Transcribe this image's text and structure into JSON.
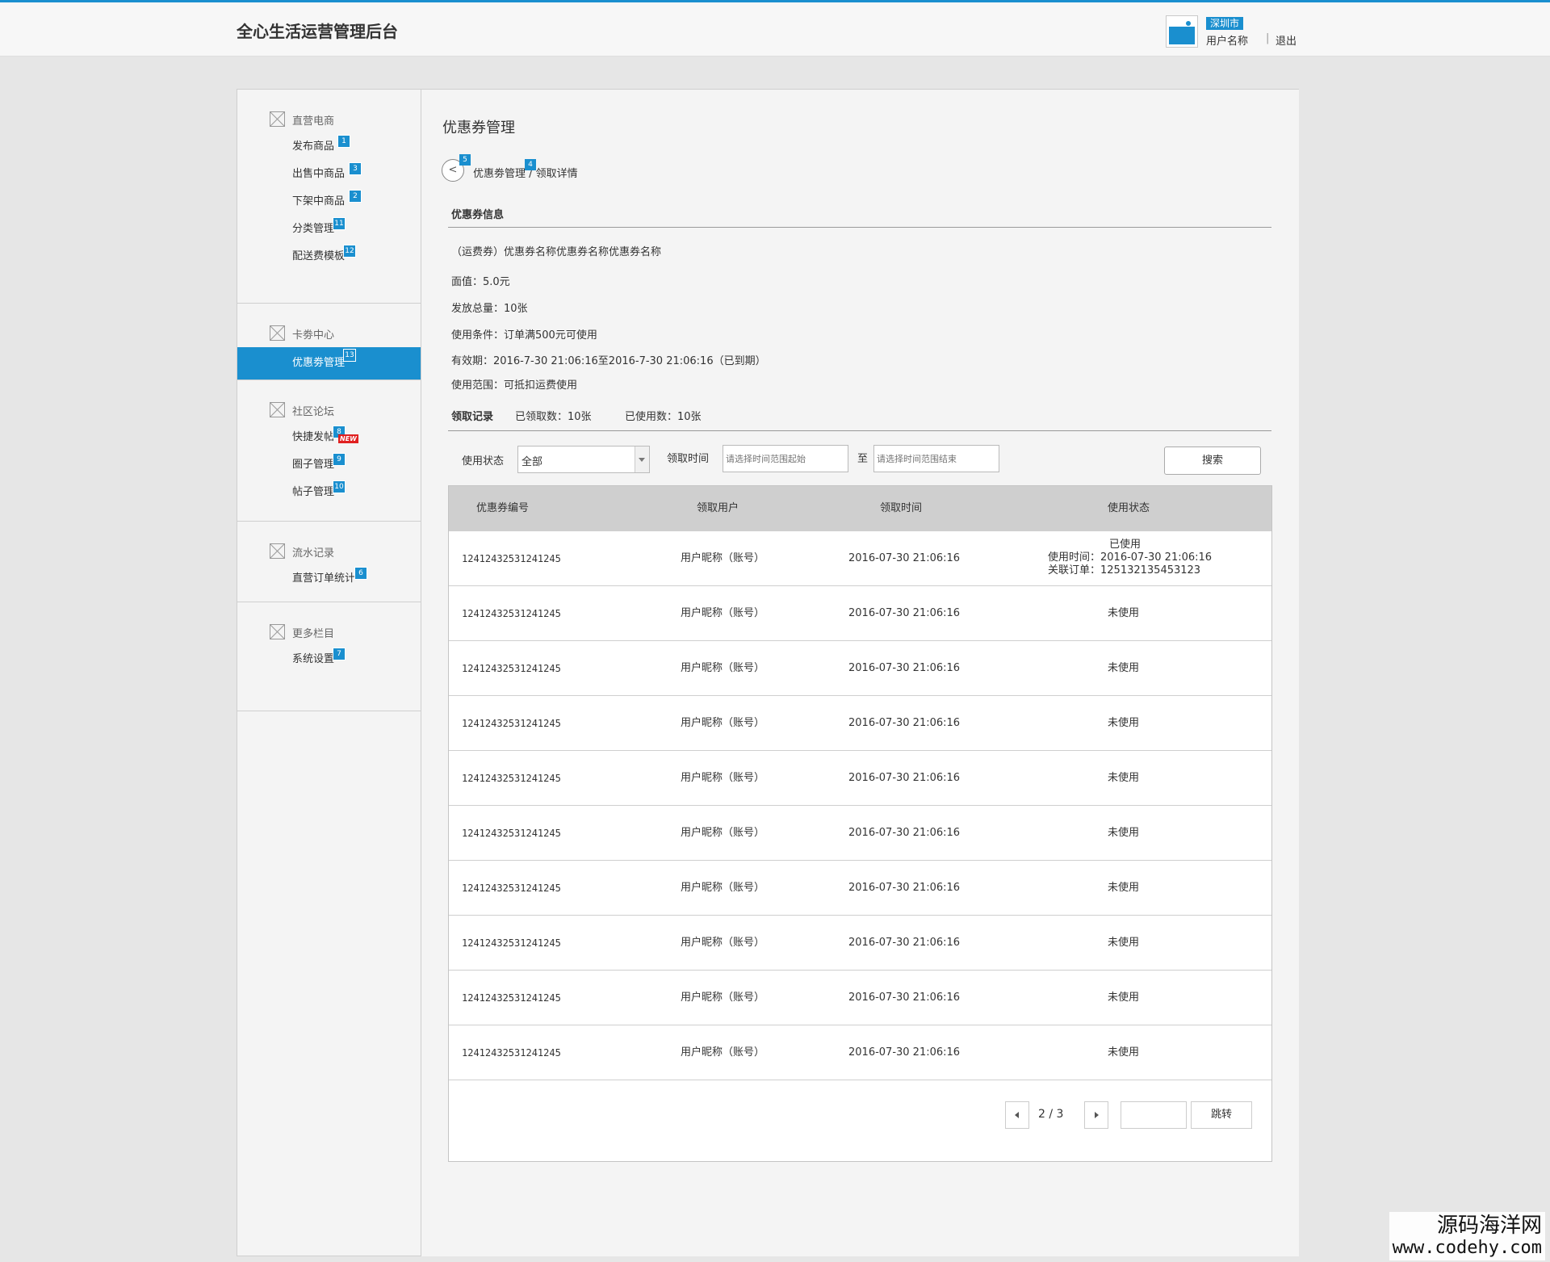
{
  "header": {
    "title": "全心生活运营管理后台",
    "city": "深圳市",
    "username": "用户名称",
    "separator": "|",
    "logout": "退出"
  },
  "sidebar": {
    "groups": [
      {
        "title": "直营电商",
        "items": [
          {
            "label": "发布商品",
            "badge": "1"
          },
          {
            "label": "出售中商品",
            "badge": "3"
          },
          {
            "label": "下架中商品",
            "badge": "2"
          },
          {
            "label": "分类管理",
            "badge": "11"
          },
          {
            "label": "配送费模板",
            "badge": "12"
          }
        ]
      },
      {
        "title": "卡劵中心",
        "items": [
          {
            "label": "优惠劵管理",
            "badge": "13",
            "active": true
          }
        ]
      },
      {
        "title": "社区论坛",
        "items": [
          {
            "label": "快捷发帖",
            "badge": "8",
            "new": "NEW"
          },
          {
            "label": "圈子管理",
            "badge": "9"
          },
          {
            "label": "帖子管理",
            "badge": "10"
          }
        ]
      },
      {
        "title": "流水记录",
        "items": [
          {
            "label": "直营订单统计",
            "badge": "6"
          }
        ]
      },
      {
        "title": "更多栏目",
        "items": [
          {
            "label": "系统设置",
            "badge": "7"
          }
        ]
      }
    ]
  },
  "main": {
    "page_title": "优惠券管理",
    "back_label": "<",
    "back_badge": "5",
    "breadcrumb": {
      "parent": "优惠劵管理",
      "parent_badge": "4",
      "sep": " / ",
      "current": "领取详情"
    },
    "info_title": "优惠券信息",
    "coupon_name": "（运费券）优惠券名称优惠券名称优惠券名称",
    "face_value": "面值：5.0元",
    "total": "发放总量：10张",
    "condition": "使用条件：订单满500元可使用",
    "validity": "有效期：2016-7-30 21:06:16至2016-7-30 21:06:16（已到期）",
    "scope": "使用范围：可抵扣运费使用",
    "records_title": "领取记录",
    "received": "已领取数：10张",
    "used": "已使用数：10张",
    "filter": {
      "status_label": "使用状态",
      "status_value": "全部",
      "time_label": "领取时间",
      "start_placeholder": "请选择时间范围起始",
      "to": "至",
      "end_placeholder": "请选择时间范围结束",
      "search": "搜索"
    },
    "table": {
      "headers": [
        "优惠券编号",
        "领取用户",
        "领取时间",
        "使用状态"
      ],
      "rows": [
        {
          "code": "12412432531241245",
          "user": "用户昵称（账号）",
          "time": "2016-07-30 21:06:16",
          "status": "已使用",
          "used_time": "使用时间：2016-07-30 21:06:16",
          "order": "关联订单：125132135453123"
        },
        {
          "code": "12412432531241245",
          "user": "用户昵称（账号）",
          "time": "2016-07-30 21:06:16",
          "status": "未使用"
        },
        {
          "code": "12412432531241245",
          "user": "用户昵称（账号）",
          "time": "2016-07-30 21:06:16",
          "status": "未使用"
        },
        {
          "code": "12412432531241245",
          "user": "用户昵称（账号）",
          "time": "2016-07-30 21:06:16",
          "status": "未使用"
        },
        {
          "code": "12412432531241245",
          "user": "用户昵称（账号）",
          "time": "2016-07-30 21:06:16",
          "status": "未使用"
        },
        {
          "code": "12412432531241245",
          "user": "用户昵称（账号）",
          "time": "2016-07-30 21:06:16",
          "status": "未使用"
        },
        {
          "code": "12412432531241245",
          "user": "用户昵称（账号）",
          "time": "2016-07-30 21:06:16",
          "status": "未使用"
        },
        {
          "code": "12412432531241245",
          "user": "用户昵称（账号）",
          "time": "2016-07-30 21:06:16",
          "status": "未使用"
        },
        {
          "code": "12412432531241245",
          "user": "用户昵称（账号）",
          "time": "2016-07-30 21:06:16",
          "status": "未使用"
        },
        {
          "code": "12412432531241245",
          "user": "用户昵称（账号）",
          "time": "2016-07-30 21:06:16",
          "status": "未使用"
        }
      ]
    },
    "pager": {
      "info": "2 / 3",
      "jump": "跳转"
    }
  },
  "watermark": {
    "line1": "源码海洋网",
    "line2": "www.codehy.com"
  },
  "colors": {
    "accent": "#1a8fcf",
    "new_badge": "#e02020"
  }
}
